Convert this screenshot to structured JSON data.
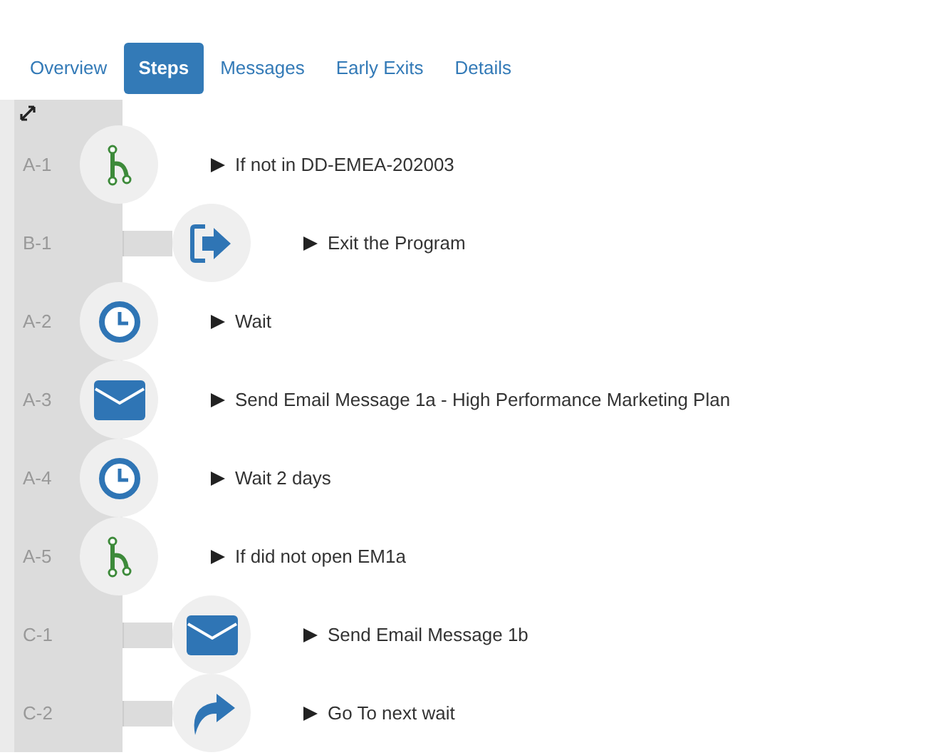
{
  "tabs": [
    {
      "label": "Overview",
      "selected": false
    },
    {
      "label": "Steps",
      "selected": true
    },
    {
      "label": "Messages",
      "selected": false
    },
    {
      "label": "Early Exits",
      "selected": false
    },
    {
      "label": "Details",
      "selected": false
    }
  ],
  "steps": [
    {
      "id": "A-1",
      "kind": "branch",
      "text": "If not in DD-EMEA-202003",
      "children": [
        {
          "id": "B-1",
          "kind": "exit",
          "text": "Exit the Program"
        }
      ]
    },
    {
      "id": "A-2",
      "kind": "wait",
      "text": "Wait"
    },
    {
      "id": "A-3",
      "kind": "email",
      "text": "Send Email Message 1a - High Performance Marketing Plan"
    },
    {
      "id": "A-4",
      "kind": "wait",
      "text": "Wait 2 days"
    },
    {
      "id": "A-5",
      "kind": "branch",
      "text": "If did not open EM1a",
      "children": [
        {
          "id": "C-1",
          "kind": "email",
          "text": "Send Email Message 1b"
        },
        {
          "id": "C-2",
          "kind": "goto",
          "text": "Go To next wait"
        }
      ]
    }
  ]
}
